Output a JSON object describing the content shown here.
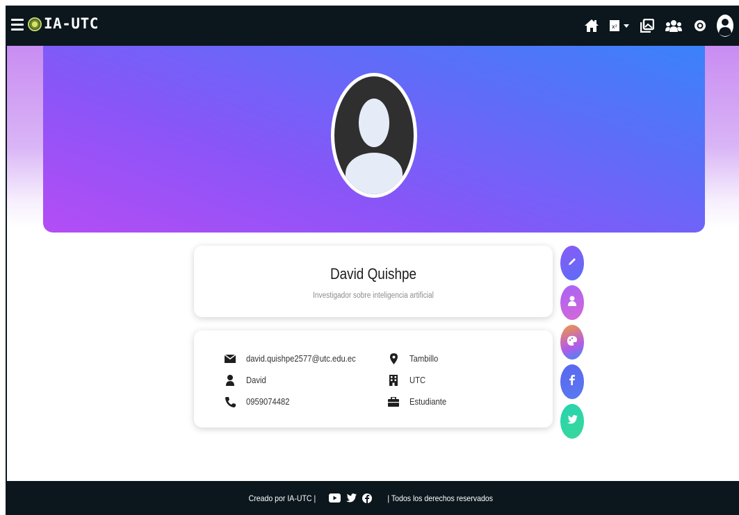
{
  "navbar": {
    "brand": "IA-UTC",
    "icons": [
      "home-icon",
      "document-dropdown-icon",
      "gallery-icon",
      "users-icon",
      "eye-icon",
      "user-account-icon"
    ]
  },
  "profile": {
    "name": "David Quishpe",
    "subtitle": "Investigador sobre inteligencia artificial"
  },
  "info": {
    "email": "david.quishpe2577@utc.edu.ec",
    "first_name": "David",
    "phone": "0959074482",
    "location": "Tambillo",
    "institution": "UTC",
    "role": "Estudiante"
  },
  "side_buttons": [
    "edit-icon",
    "user-icon",
    "palette-icon",
    "facebook-icon",
    "twitter-icon"
  ],
  "footer": {
    "left_text": "Creado por IA-UTC |",
    "right_text": "| Todos los derechos reservados"
  },
  "colors": {
    "navbar": "#0b171d",
    "hero_start": "#b44df6",
    "hero_end": "#3a82f9"
  }
}
